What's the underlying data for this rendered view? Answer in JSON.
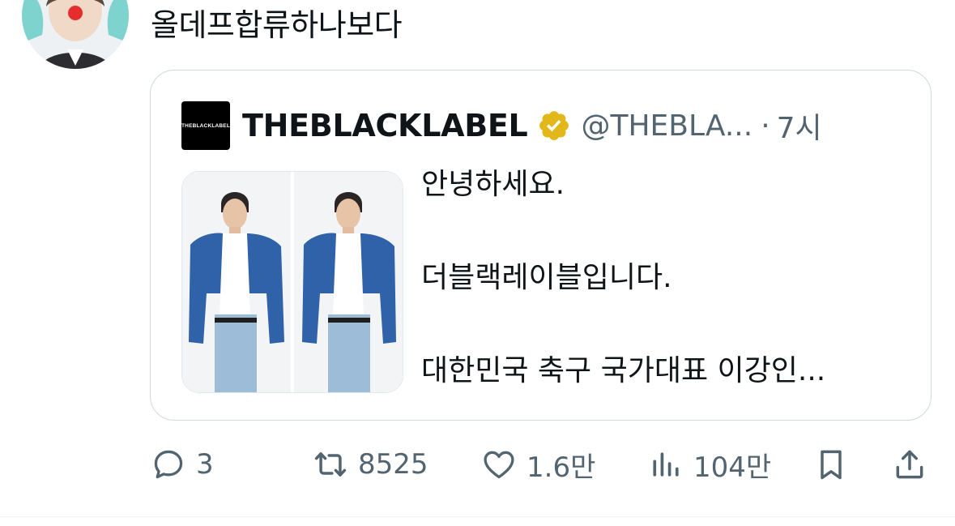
{
  "tweet": {
    "text": "올데프합류하나보다"
  },
  "quote": {
    "logo_text": "THEBLACKLABEL",
    "display_name": "THEBLACKLABEL",
    "handle": "@THEBLA...",
    "separator": "·",
    "time": "7시",
    "lines": [
      "안녕하세요.",
      "더블랙레이블입니다.",
      "대한민국 축구 국가대표 이강인..."
    ]
  },
  "actions": {
    "replies": "3",
    "retweets": "8525",
    "likes": "1.6만",
    "views": "104만"
  },
  "colors": {
    "text": "#0f1419",
    "secondary": "#536471",
    "border": "#cfd9de",
    "verified_gold": "#e2b719"
  }
}
